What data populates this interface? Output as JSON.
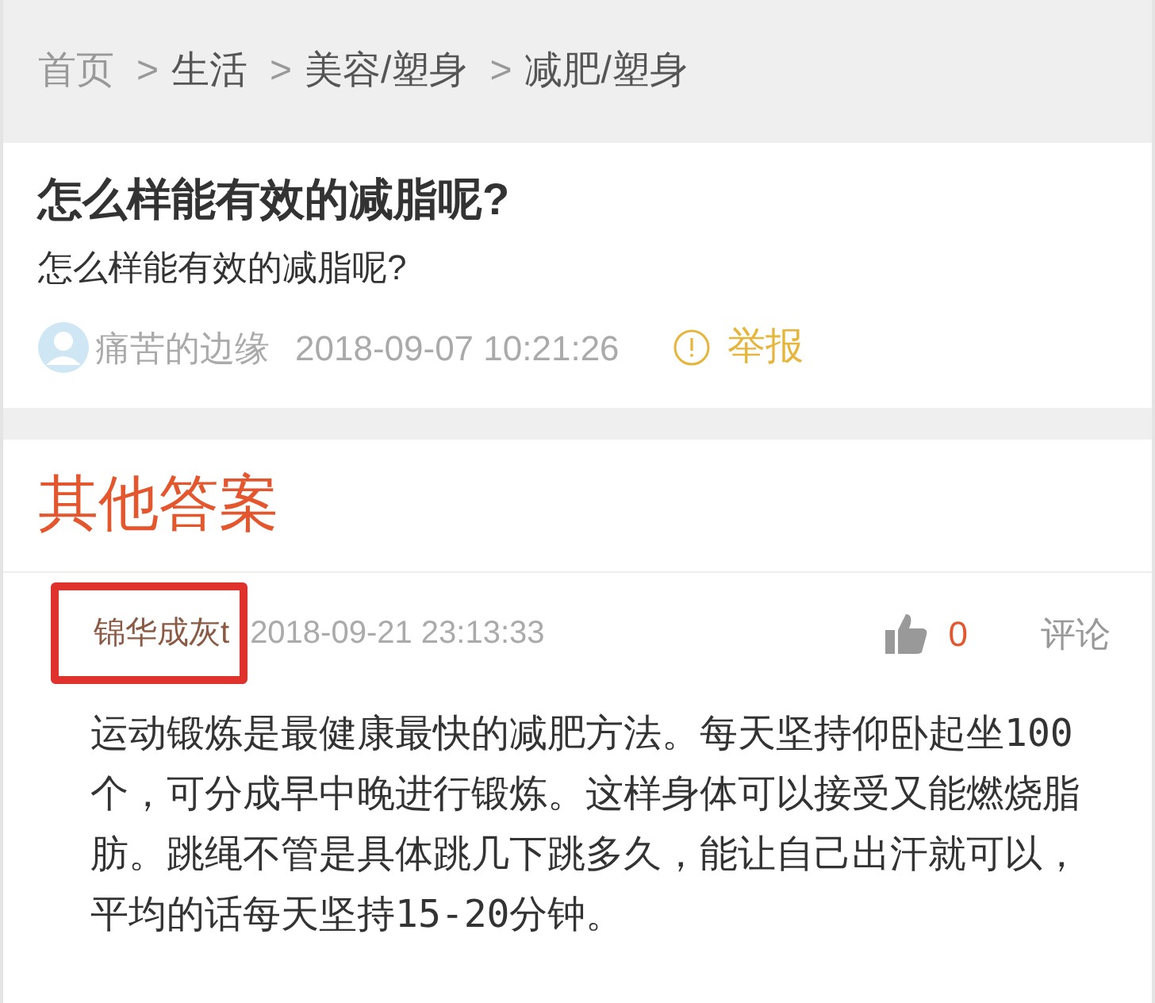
{
  "breadcrumb": [
    {
      "label": "首页"
    },
    {
      "label": "生活",
      "separator": ">"
    },
    {
      "label": "美容/塑身",
      "separator": ">"
    },
    {
      "label": "减肥/塑身",
      "separator": ">"
    }
  ],
  "question": {
    "title": "怎么样能有效的减脂呢?",
    "body": "怎么样能有效的减脂呢?",
    "author": "痛苦的边缘",
    "time": "2018-09-07 10:21:26",
    "report": "举报"
  },
  "answers_heading": "其他答案",
  "answers": [
    {
      "author": "锦华成灰t",
      "highlighted": true,
      "time": "2018-09-21 23:13:33",
      "likes": "0",
      "comment": "评论",
      "text": "运动锻炼是最健康最快的减肥方法。每天坚持仰卧起坐100个，可分成早中晚进行锻炼。这样身体可以接受又能燃烧脂肪。跳绳不管是具体跳几下跳多久，能让自己出汗就可以，平均的话每天坚持15-20分钟。"
    }
  ]
}
